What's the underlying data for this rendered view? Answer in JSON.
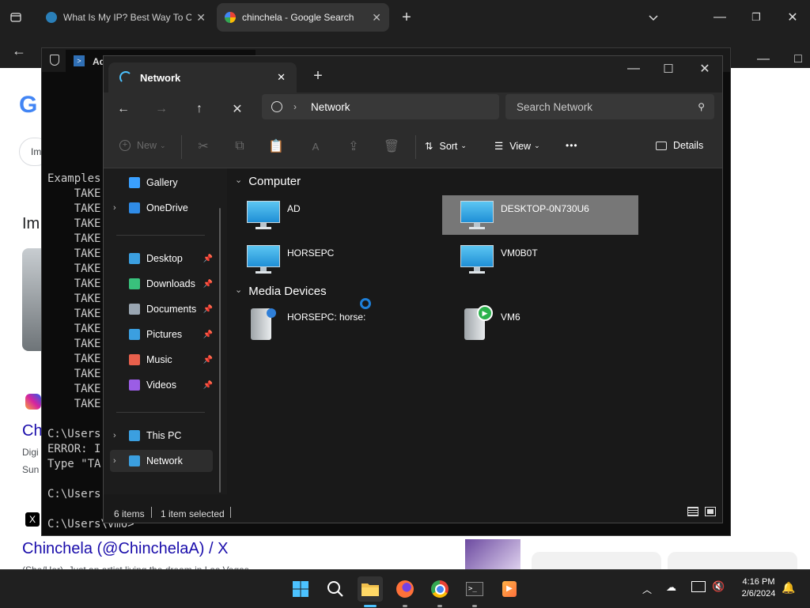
{
  "browser": {
    "tabs": [
      {
        "title": "What Is My IP? Best Way To Ch",
        "active": false
      },
      {
        "title": "chinchela - Google Search",
        "active": true
      }
    ],
    "new_tab": "+"
  },
  "google": {
    "logo": "G",
    "chip": "Im",
    "images_heading": "Im",
    "result1_title": "Chi",
    "result1_line1": "Digi",
    "result1_line2": "Sun",
    "result2_title": "Chinchela (@ChinchelaA) / X",
    "result2_snippet": "(She/Her). Just an artist living the dream in Las Vegas"
  },
  "terminal": {
    "title": "Ad",
    "lines": [
      "Examples",
      "    TAKE",
      "    TAKE",
      "    TAKE",
      "    TAKE",
      "    TAKE",
      "    TAKE",
      "    TAKE",
      "    TAKE",
      "    TAKE",
      "    TAKE",
      "    TAKE",
      "    TAKE",
      "    TAKE",
      "    TAKE",
      "    TAKE",
      "",
      "C:\\Users",
      "ERROR: I",
      "Type \"TA",
      "",
      "C:\\Users",
      "",
      "C:\\Users\\vm6>"
    ]
  },
  "explorer": {
    "tab_title": "Network",
    "address": "Network",
    "search_placeholder": "Search Network",
    "toolbar": {
      "new_label": "New",
      "sort_label": "Sort",
      "view_label": "View",
      "more_label": "•••",
      "details_label": "Details"
    },
    "sidebar": [
      {
        "label": "Gallery",
        "icon": "gallery-icon",
        "pinned": false,
        "expand": false
      },
      {
        "label": "OneDrive",
        "icon": "cloud-icon",
        "pinned": false,
        "expand": true
      },
      {
        "label": "Desktop",
        "icon": "desktop-icon",
        "pinned": true,
        "expand": false
      },
      {
        "label": "Downloads",
        "icon": "download-icon",
        "pinned": true,
        "expand": false
      },
      {
        "label": "Documents",
        "icon": "documents-icon",
        "pinned": true,
        "expand": false
      },
      {
        "label": "Pictures",
        "icon": "pictures-icon",
        "pinned": true,
        "expand": false
      },
      {
        "label": "Music",
        "icon": "music-icon",
        "pinned": true,
        "expand": false
      },
      {
        "label": "Videos",
        "icon": "videos-icon",
        "pinned": true,
        "expand": false
      },
      {
        "label": "This PC",
        "icon": "pc-icon",
        "pinned": false,
        "expand": true
      },
      {
        "label": "Network",
        "icon": "network-icon",
        "pinned": false,
        "expand": true,
        "selected": true
      }
    ],
    "groups": [
      {
        "name": "Computer",
        "items": [
          {
            "label": "AD",
            "selected": false
          },
          {
            "label": "DESKTOP-0N730U6",
            "selected": true
          },
          {
            "label": "HORSEPC",
            "selected": false
          },
          {
            "label": "VM0B0T",
            "selected": false
          }
        ]
      },
      {
        "name": "Media Devices",
        "items": [
          {
            "label": "HORSEPC: horse:",
            "selected": false
          },
          {
            "label": "VM6",
            "selected": false
          }
        ]
      }
    ],
    "status": {
      "items": "6 items",
      "selected": "1 item selected"
    }
  },
  "taskbar": {
    "time": "4:16 PM",
    "date": "2/6/2024",
    "apps": [
      "start-icon",
      "search-icon",
      "file-explorer-icon",
      "firefox-icon",
      "chrome-icon",
      "terminal-icon",
      "media-player-icon"
    ]
  }
}
